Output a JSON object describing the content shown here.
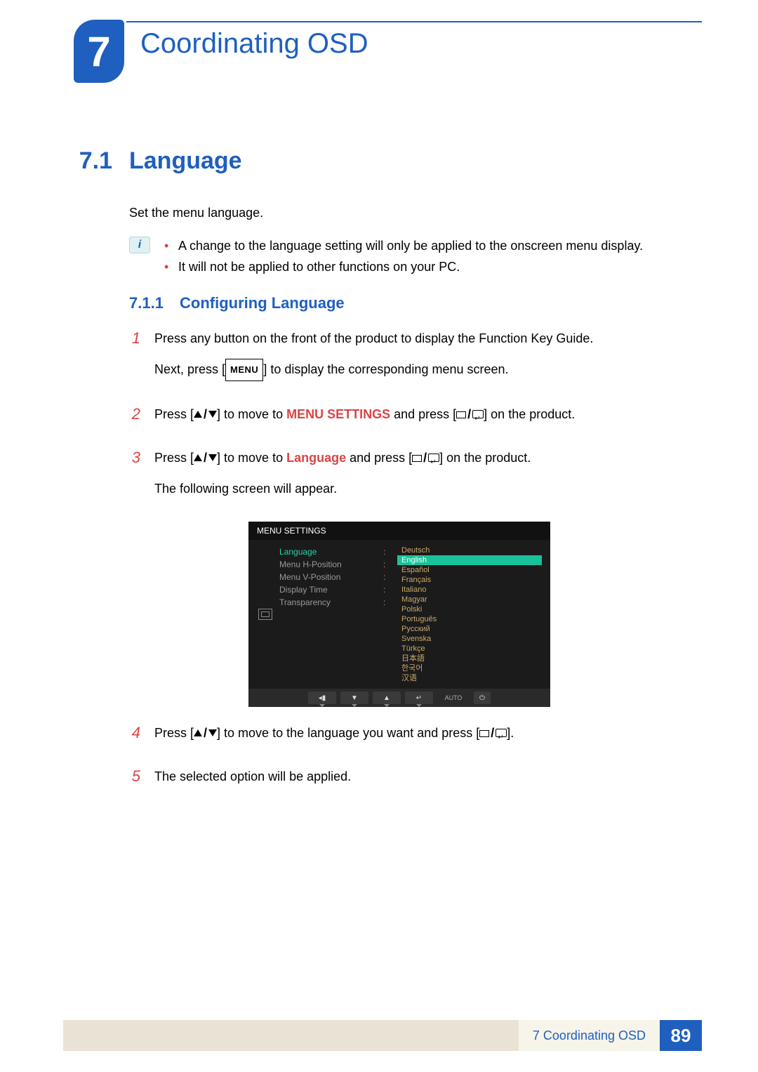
{
  "chapter": {
    "number": "7",
    "title": "Coordinating OSD"
  },
  "section": {
    "number": "7.1",
    "title": "Language",
    "intro": "Set the menu language."
  },
  "notes": [
    "A change to the language setting will only be applied to the onscreen menu display.",
    "It will not be applied to other functions on your PC."
  ],
  "subsection": {
    "number": "7.1.1",
    "title": "Configuring Language"
  },
  "steps": {
    "s1a": "Press any button on the front of the product to display the Function Key Guide.",
    "s1b_pre": "Next, press [",
    "s1b_btn": "MENU",
    "s1b_post": "] to display the corresponding menu screen.",
    "s2_pre": "Press [",
    "s2_mid": "] to move to ",
    "s2_kw": "MENU SETTINGS",
    "s2_post1": " and press [",
    "s2_post2": "] on the product.",
    "s3_pre": "Press [",
    "s3_mid": "] to move to ",
    "s3_kw": "Language",
    "s3_post1": " and press [",
    "s3_post2": "] on the product.",
    "s3_tail": "The following screen will appear.",
    "s4_pre": "Press [",
    "s4_mid": "] to move to the language you want and press [",
    "s4_post": "].",
    "s5": "The selected option will be applied."
  },
  "step_nums": {
    "n1": "1",
    "n2": "2",
    "n3": "3",
    "n4": "4",
    "n5": "5"
  },
  "osd": {
    "title": "MENU SETTINGS",
    "menu": [
      "Language",
      "Menu H-Position",
      "Menu V-Position",
      "Display Time",
      "Transparency"
    ],
    "selected_menu_index": 0,
    "languages": [
      "Deutsch",
      "English",
      "Español",
      "Français",
      "Italiano",
      "Magyar",
      "Polski",
      "Português",
      "Русский",
      "Svenska",
      "Türkçe",
      "日本語",
      "한국어",
      "汉语"
    ],
    "selected_language_index": 1,
    "footer_auto": "AUTO"
  },
  "footer": {
    "text": "7 Coordinating OSD",
    "page": "89"
  }
}
